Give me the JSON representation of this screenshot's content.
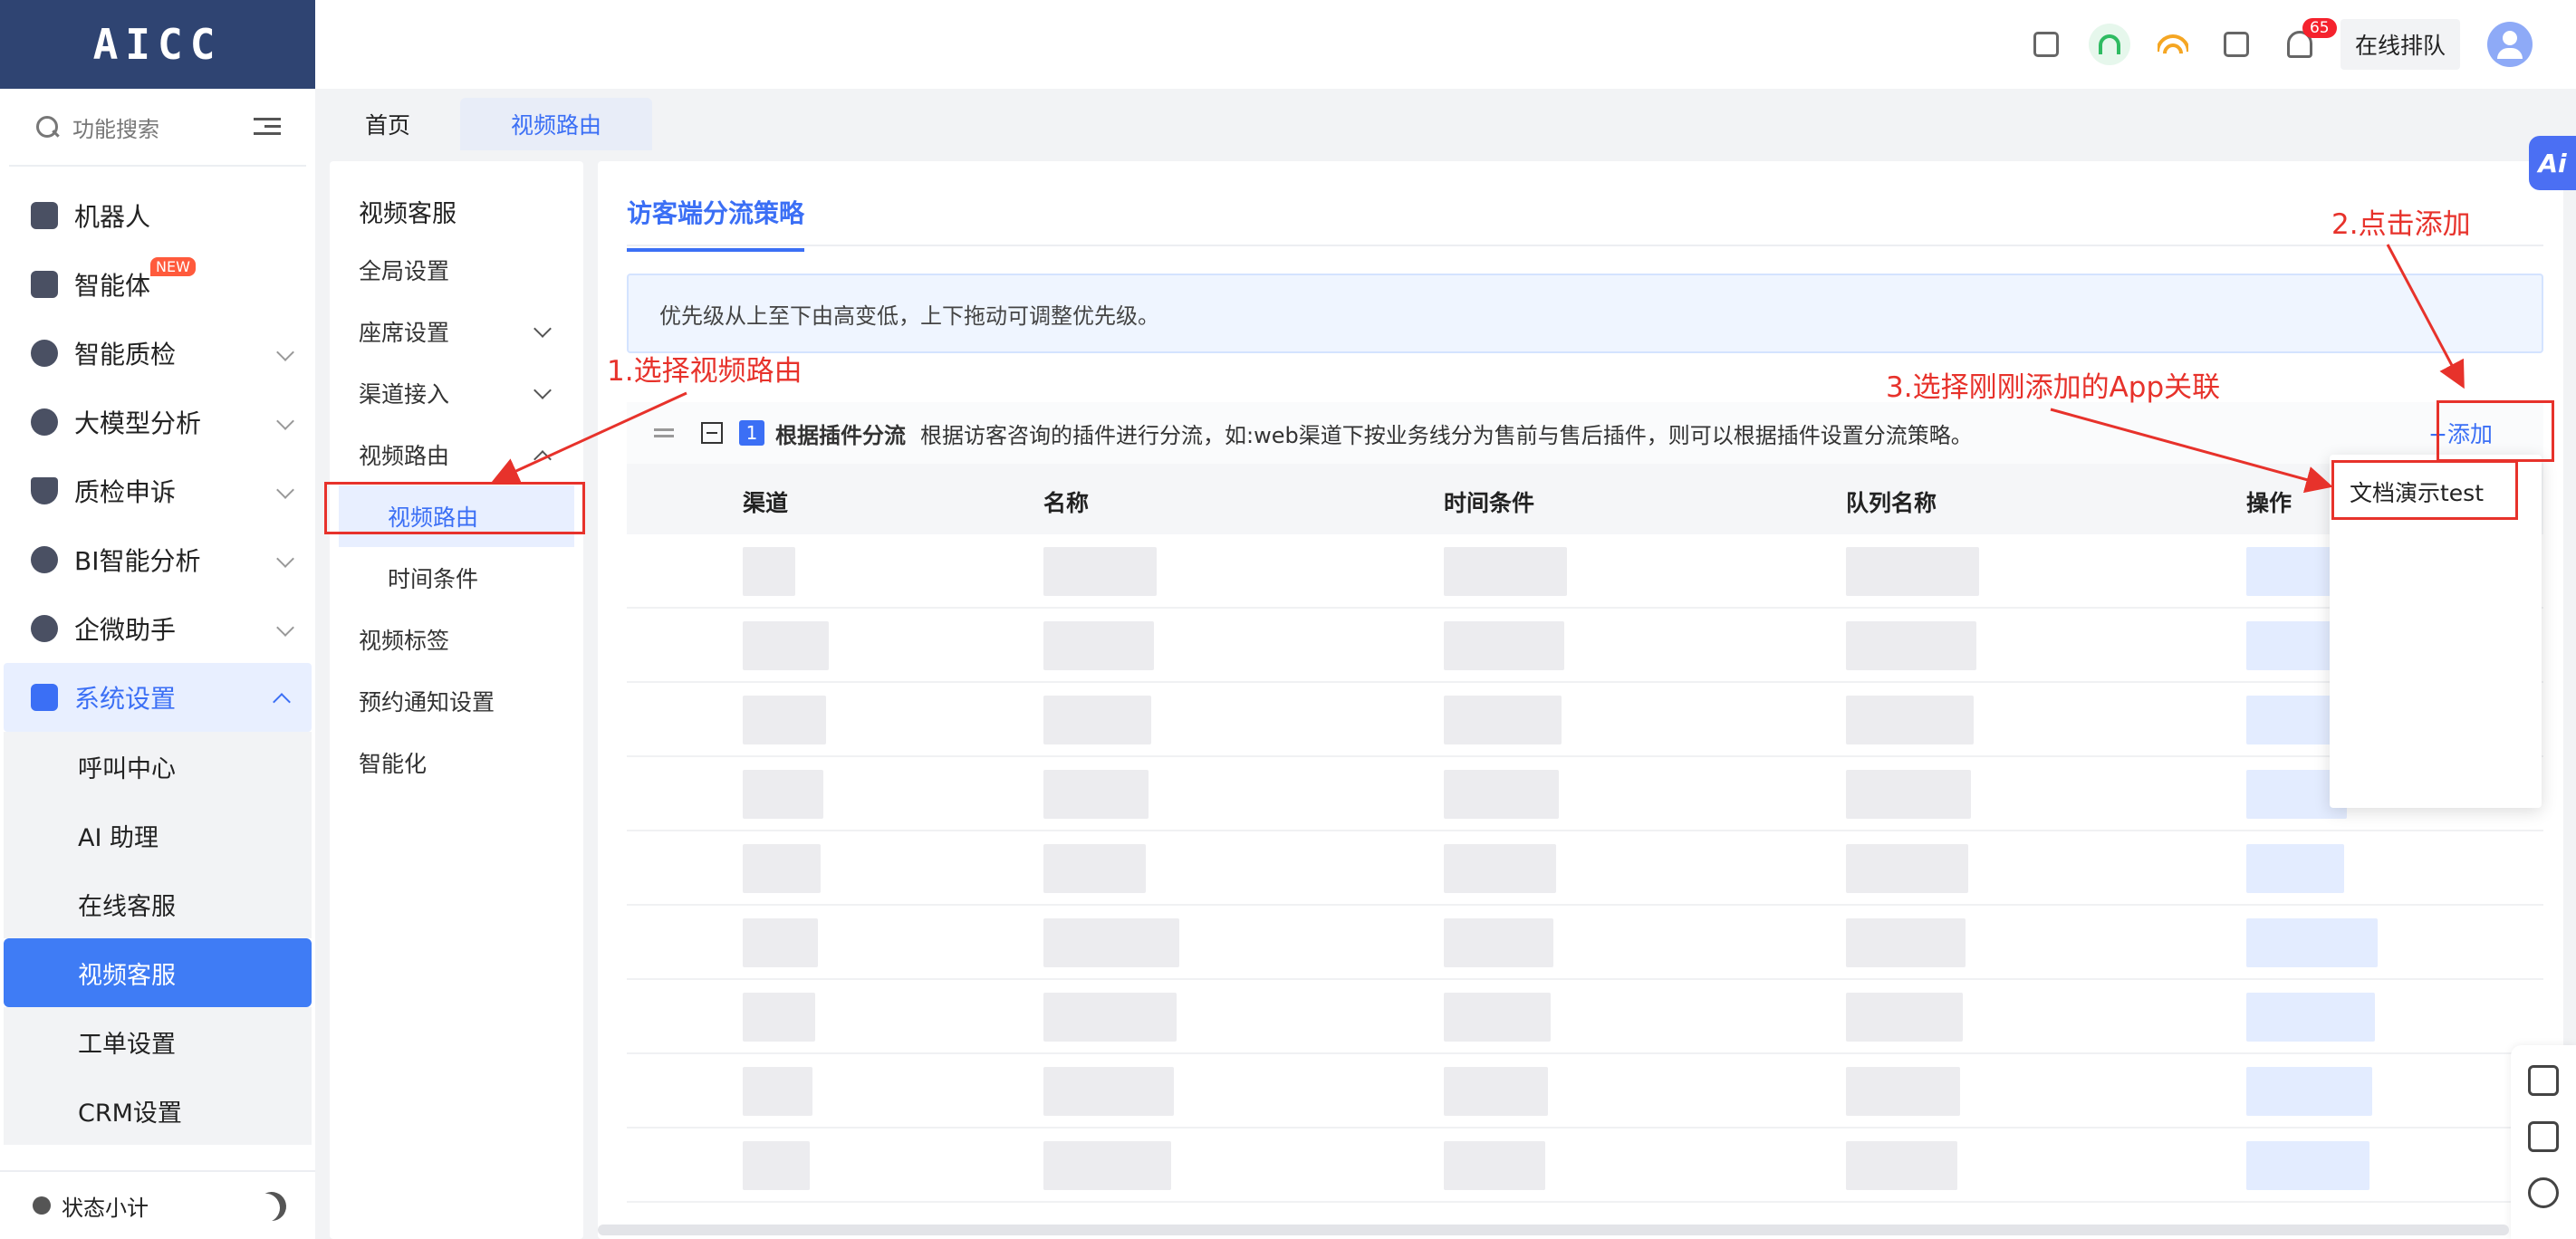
{
  "logo": {
    "text": "AICC"
  },
  "search": {
    "placeholder": "功能搜索"
  },
  "sidebar": {
    "items": [
      {
        "label": "机器人"
      },
      {
        "label": "智能体",
        "badge": "NEW"
      },
      {
        "label": "智能质检"
      },
      {
        "label": "大模型分析"
      },
      {
        "label": "质检申诉"
      },
      {
        "label": "BI智能分析"
      },
      {
        "label": "企微助手"
      },
      {
        "label": "系统设置"
      }
    ],
    "subitems": [
      "呼叫中心",
      "AI 助理",
      "在线客服",
      "视频客服",
      "工单设置",
      "CRM设置"
    ],
    "footer": "状态小计"
  },
  "header": {
    "notification_count": "65",
    "queue_button": "在线排队"
  },
  "tabs": [
    "首页",
    "视频路由"
  ],
  "menu2": {
    "title": "视频客服",
    "items": [
      "全局设置",
      "座席设置",
      "渠道接入",
      "视频路由"
    ],
    "subitems": [
      "视频路由",
      "时间条件"
    ],
    "items2": [
      "视频标签",
      "预约通知设置",
      "智能化"
    ]
  },
  "main": {
    "tab": "访客端分流策略",
    "info": "优先级从上至下由高变低，上下拖动可调整优先级。",
    "rule": {
      "number": "1",
      "title": "根据插件分流",
      "desc": "根据访客咨询的插件进行分流，如:web渠道下按业务线分为售前与售后插件，则可以根据插件设置分流策略。"
    },
    "add_button": "+添加",
    "columns": [
      "渠道",
      "名称",
      "时间条件",
      "队列名称",
      "操作"
    ]
  },
  "dropdown": {
    "option": "文档演示test"
  },
  "annotations": {
    "step1": "1.选择视频路由",
    "step2": "2.点击添加",
    "step3": "3.选择刚刚添加的App关联"
  },
  "floating": {
    "ai": "Ai"
  },
  "colors": {
    "accent": "#3b6ff5",
    "annotation": "#e7322b",
    "logo_bg": "#2f4472"
  }
}
